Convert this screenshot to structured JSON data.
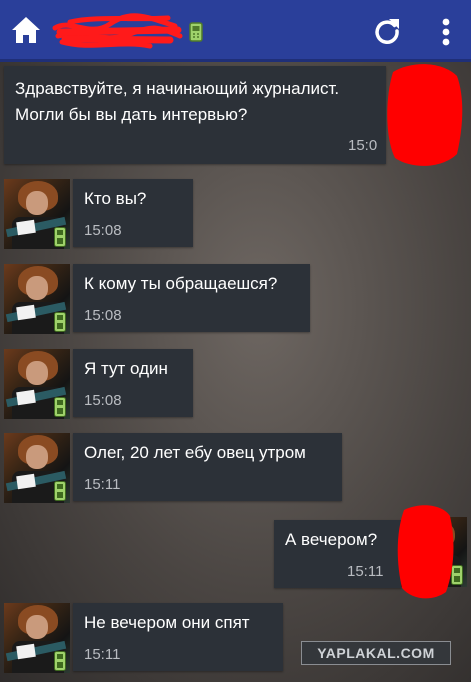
{
  "colors": {
    "topbar": "#2a3f9a",
    "bubble": "#2c3138",
    "text": "#ffffff",
    "time": "#b9bcc1",
    "redaction": "#ff0000",
    "online_badge": "#7ec242"
  },
  "topbar": {
    "home_icon": "home-icon",
    "device_icon": "phone-icon",
    "refresh_icon": "refresh-icon",
    "menu_icon": "more-vert-icon"
  },
  "messages": [
    {
      "direction": "outgoing",
      "line1": "Здравствуйте, я начинающий журналист.",
      "line2": "Могли бы вы дать интервью?",
      "time": "15:0"
    },
    {
      "direction": "incoming",
      "text": "Кто вы?",
      "time": "15:08"
    },
    {
      "direction": "incoming",
      "text": "К кому ты обращаешся?",
      "time": "15:08"
    },
    {
      "direction": "incoming",
      "text": "Я тут один",
      "time": "15:08"
    },
    {
      "direction": "incoming",
      "text": "Олег, 20 лет ебу овец утром",
      "time": "15:11"
    },
    {
      "direction": "outgoing",
      "text": "А вечером?",
      "time": "15:11"
    },
    {
      "direction": "incoming",
      "text": "Не вечером они спят",
      "time": "15:11"
    }
  ],
  "watermark": "YAPLAKAL.COM"
}
